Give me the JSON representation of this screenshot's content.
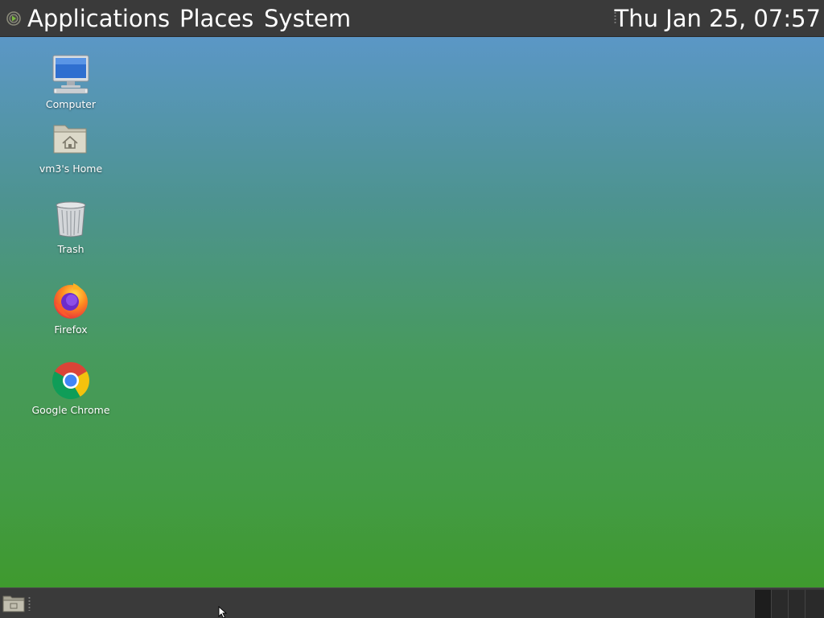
{
  "top_panel": {
    "menus": [
      "Applications",
      "Places",
      "System"
    ],
    "clock": "Thu Jan 25, 07:57"
  },
  "desktop_icons": [
    {
      "label": "Computer",
      "icon": "computer-icon"
    },
    {
      "label": "vm3's Home",
      "icon": "home-folder-icon"
    },
    {
      "label": "Trash",
      "icon": "trash-icon"
    },
    {
      "label": "Firefox",
      "icon": "firefox-icon"
    },
    {
      "label": "Google Chrome",
      "icon": "chrome-icon"
    }
  ],
  "bottom_panel": {
    "show_desktop_icon": "show-desktop-icon",
    "workspace_count": 4
  },
  "colors": {
    "panel": "#3a3a3a",
    "desktop_top": "#5b97c6",
    "desktop_bottom": "#3f9a2e"
  }
}
